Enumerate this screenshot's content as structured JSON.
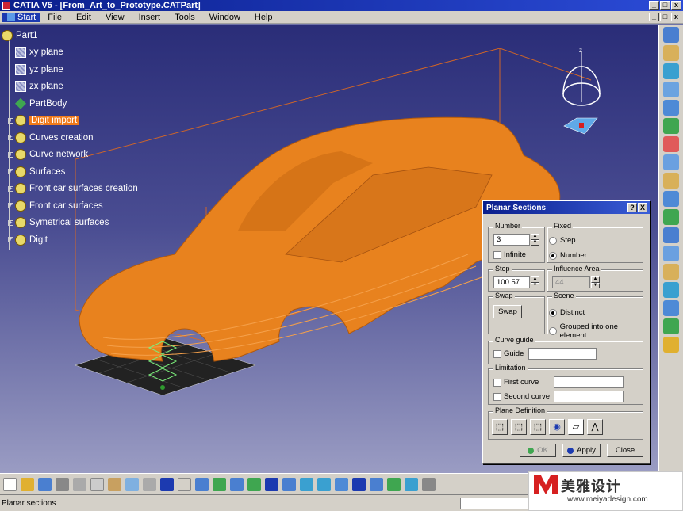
{
  "window": {
    "title": "CATIA V5 - [From_Art_to_Prototype.CATPart]",
    "controls": [
      "_",
      "□",
      "x"
    ]
  },
  "menubar": {
    "items": [
      "Start",
      "File",
      "Edit",
      "View",
      "Insert",
      "Tools",
      "Window",
      "Help"
    ]
  },
  "tree": {
    "root": "Part1",
    "items": [
      {
        "label": "xy plane",
        "icon": "plane-icon",
        "expander": false,
        "selected": false
      },
      {
        "label": "yz plane",
        "icon": "plane-icon",
        "expander": false,
        "selected": false
      },
      {
        "label": "zx plane",
        "icon": "plane-icon",
        "expander": false,
        "selected": false
      },
      {
        "label": "PartBody",
        "icon": "partbody-icon",
        "expander": false,
        "selected": false
      },
      {
        "label": "Digit import",
        "icon": "geometric-set-icon",
        "expander": true,
        "selected": true
      },
      {
        "label": "Curves creation",
        "icon": "geometric-set-icon",
        "expander": true,
        "selected": false
      },
      {
        "label": "Curve network",
        "icon": "geometric-set-icon",
        "expander": true,
        "selected": false
      },
      {
        "label": "Surfaces",
        "icon": "geometric-set-icon",
        "expander": true,
        "selected": false
      },
      {
        "label": "Front car surfaces creation",
        "icon": "geometric-set-icon",
        "expander": true,
        "selected": false
      },
      {
        "label": "Front car surfaces",
        "icon": "geometric-set-icon",
        "expander": true,
        "selected": false
      },
      {
        "label": "Symetrical surfaces",
        "icon": "geometric-set-icon",
        "expander": true,
        "selected": false
      },
      {
        "label": "Digit",
        "icon": "geometric-set-icon",
        "expander": true,
        "selected": false
      }
    ]
  },
  "compass": {
    "axis_label": "z"
  },
  "dialog": {
    "title": "Planar Sections",
    "title_buttons": [
      "?",
      "X"
    ],
    "number": {
      "legend": "Number",
      "value": "3",
      "infinite_label": "Infinite"
    },
    "fixed": {
      "legend": "Fixed",
      "options": [
        "Step",
        "Number"
      ],
      "selected": "Number"
    },
    "step": {
      "legend": "Step",
      "value": "100.57"
    },
    "influence": {
      "legend": "Influence Area",
      "value": "44"
    },
    "swap": {
      "legend": "Swap",
      "button": "Swap"
    },
    "scene": {
      "legend": "Scene",
      "options": [
        "Distinct",
        "Grouped into one element"
      ],
      "selected": "Distinct"
    },
    "curve_guide": {
      "legend": "Curve guide",
      "checkbox": "Guide"
    },
    "limitation": {
      "legend": "Limitation",
      "first": "First curve",
      "second": "Second curve"
    },
    "plane_definition": {
      "legend": "Plane Definition",
      "icons": [
        "plane-x-icon",
        "plane-y-icon",
        "plane-z-icon",
        "compass-plane-icon",
        "plane-surface-icon",
        "plane-curve-icon"
      ]
    },
    "buttons": {
      "ok": "OK",
      "apply": "Apply",
      "close": "Close"
    }
  },
  "statusbar": {
    "text": "Planar sections"
  },
  "watermark": {
    "brand": "美雅设计",
    "url": "www.meiyadesign.com"
  }
}
